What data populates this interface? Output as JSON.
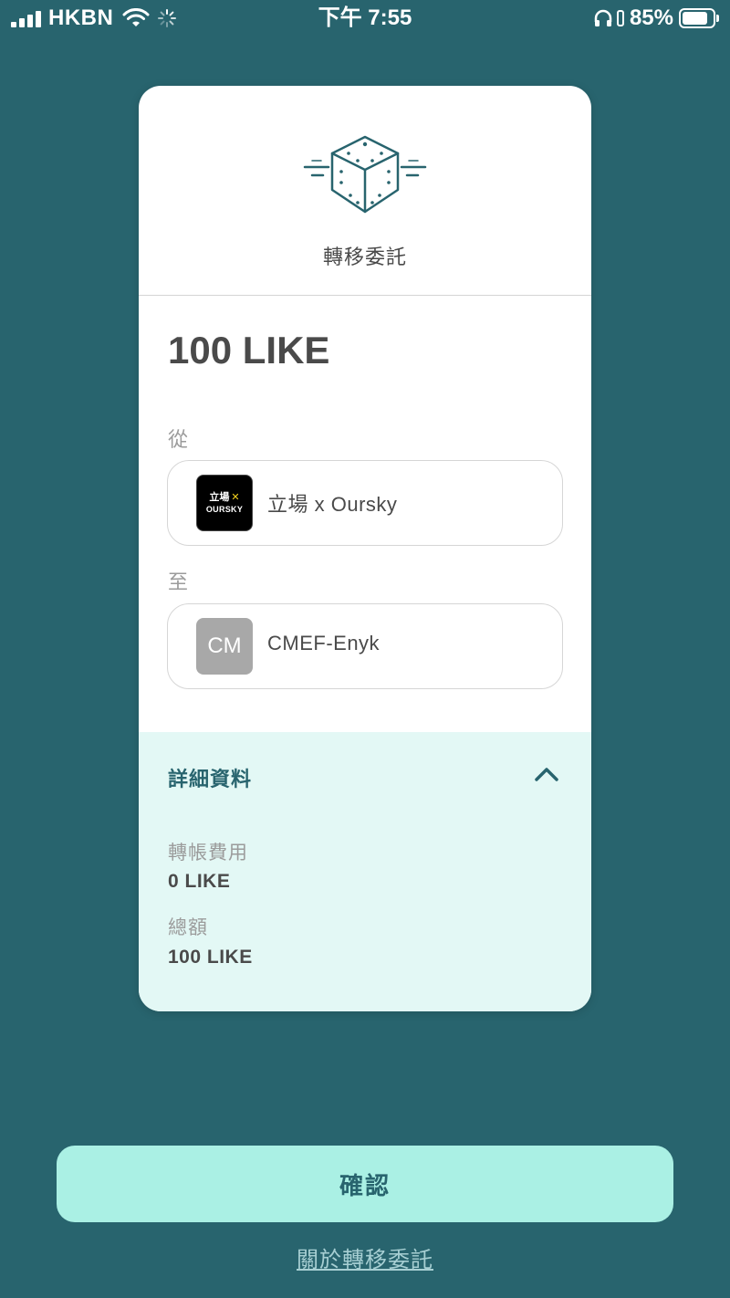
{
  "status_bar": {
    "carrier": "HKBN",
    "time": "下午 7:55",
    "battery": "85%"
  },
  "card": {
    "title": "轉移委託",
    "amount": "100 LIKE",
    "from": {
      "label": "從",
      "name": "立場 x Oursky",
      "logo_line1": "立場",
      "logo_x": "✕",
      "logo_line2": "OURSKY"
    },
    "to": {
      "label": "至",
      "initials": "CM",
      "name": "CMEF-Enyk"
    },
    "details": {
      "title": "詳細資料",
      "fee_label": "轉帳費用",
      "fee_value": "0 LIKE",
      "total_label": "總額",
      "total_value": "100 LIKE"
    }
  },
  "actions": {
    "confirm": "確認",
    "about": "關於轉移委託"
  },
  "colors": {
    "background": "#28646e",
    "accent": "#aaf0e4",
    "details_bg": "#e3f8f5"
  }
}
